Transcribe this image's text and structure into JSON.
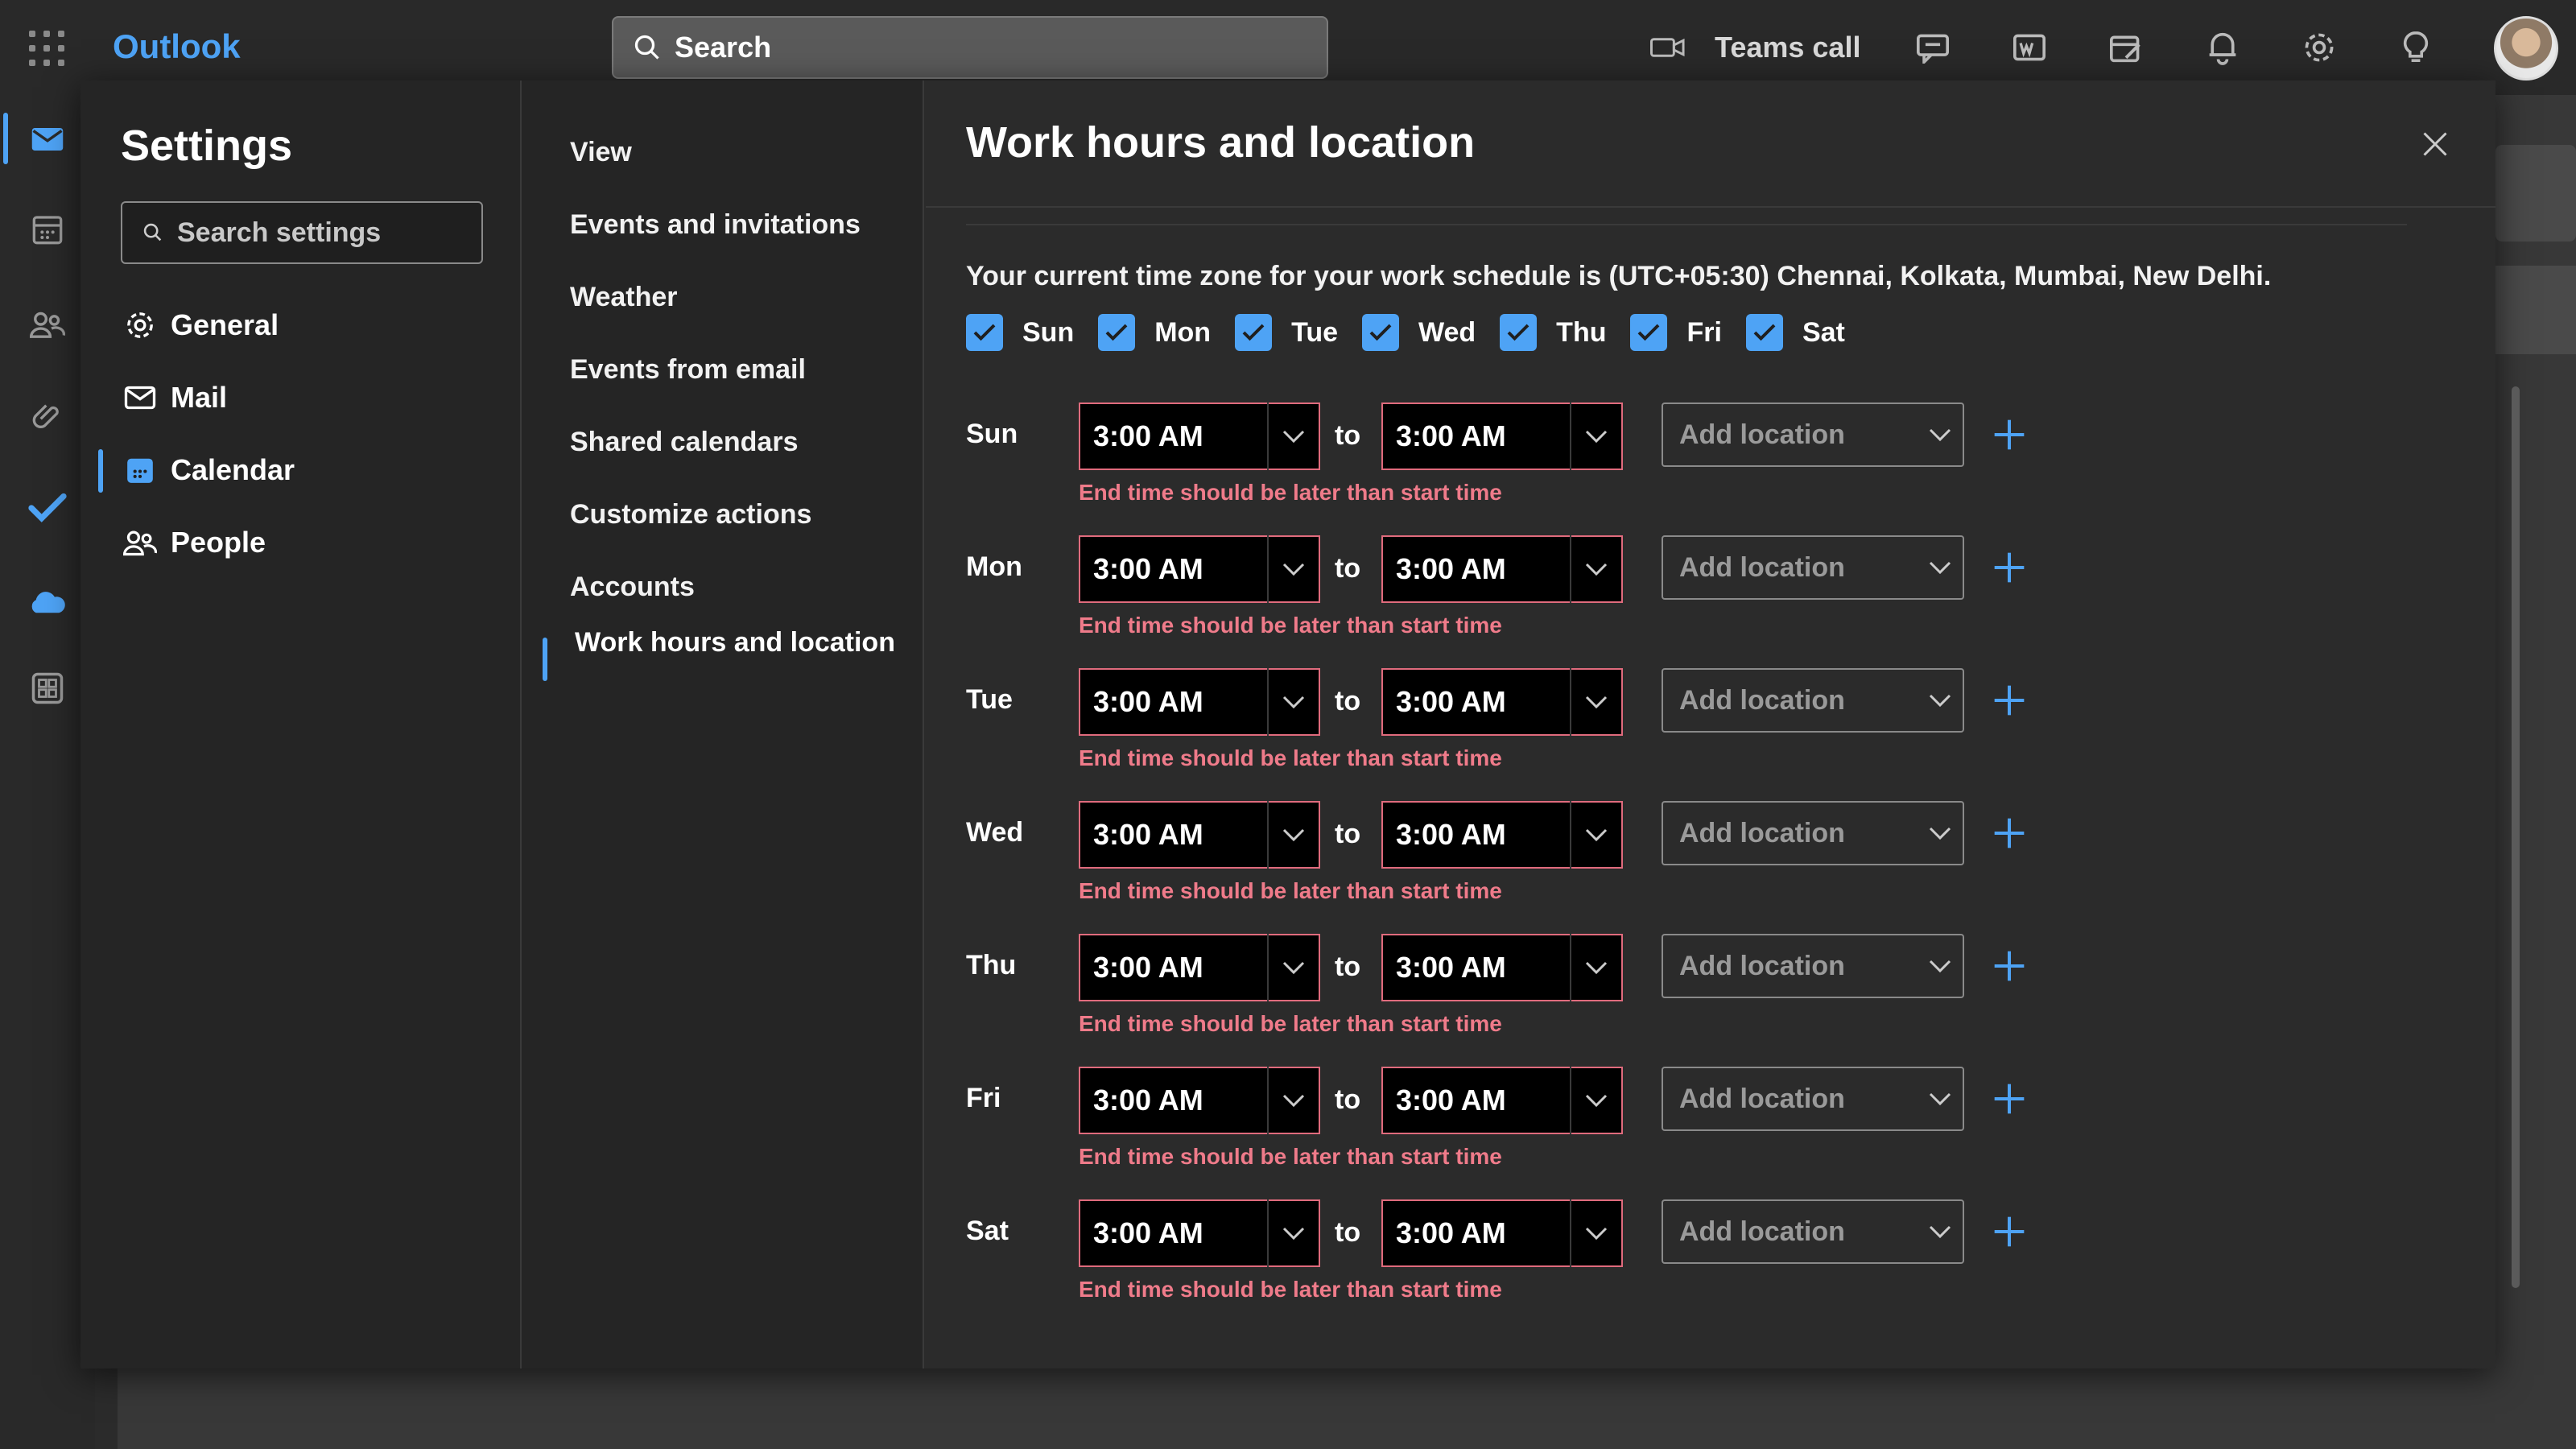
{
  "app": {
    "name": "Outlook"
  },
  "topbar": {
    "search_placeholder": "Search",
    "teams_call_label": "Teams call",
    "icons": [
      "video-icon",
      "chat-icon",
      "word-icon",
      "calendar-edit-icon",
      "bell-icon",
      "gear-icon",
      "lightbulb-icon"
    ]
  },
  "rail": {
    "icons": [
      "mail-icon",
      "calendar-icon",
      "people-icon",
      "attachment-icon",
      "todo-icon",
      "onedrive-icon",
      "apps-icon"
    ]
  },
  "settings": {
    "title": "Settings",
    "search_placeholder": "Search settings",
    "nav": [
      {
        "label": "General",
        "icon": "gear-icon"
      },
      {
        "label": "Mail",
        "icon": "mail-icon"
      },
      {
        "label": "Calendar",
        "icon": "calendar-icon",
        "active": true
      },
      {
        "label": "People",
        "icon": "people-icon"
      }
    ],
    "subnav": [
      "View",
      "Events and invitations",
      "Weather",
      "Events from email",
      "Shared calendars",
      "Customize actions",
      "Accounts"
    ],
    "subnav_selected": "Work hours and location"
  },
  "content": {
    "title": "Work hours and location",
    "timezone_text": "Your current time zone for your work schedule is (UTC+05:30) Chennai, Kolkata, Mumbai, New Delhi.",
    "day_checks": [
      {
        "label": "Sun",
        "checked": true
      },
      {
        "label": "Mon",
        "checked": true
      },
      {
        "label": "Tue",
        "checked": true
      },
      {
        "label": "Wed",
        "checked": true
      },
      {
        "label": "Thu",
        "checked": true
      },
      {
        "label": "Fri",
        "checked": true
      },
      {
        "label": "Sat",
        "checked": true
      }
    ],
    "to_label": "to",
    "location_placeholder": "Add location",
    "error_text": "End time should be later than start time",
    "rows": [
      {
        "day": "Sun",
        "start": "3:00 AM",
        "end": "3:00 AM"
      },
      {
        "day": "Mon",
        "start": "3:00 AM",
        "end": "3:00 AM"
      },
      {
        "day": "Tue",
        "start": "3:00 AM",
        "end": "3:00 AM"
      },
      {
        "day": "Wed",
        "start": "3:00 AM",
        "end": "3:00 AM"
      },
      {
        "day": "Thu",
        "start": "3:00 AM",
        "end": "3:00 AM"
      },
      {
        "day": "Fri",
        "start": "3:00 AM",
        "end": "3:00 AM"
      },
      {
        "day": "Sat",
        "start": "3:00 AM",
        "end": "3:00 AM"
      }
    ]
  },
  "colors": {
    "accent": "#4ea3f5",
    "error": "#ef7b8a",
    "error_border": "#e06b7d"
  }
}
